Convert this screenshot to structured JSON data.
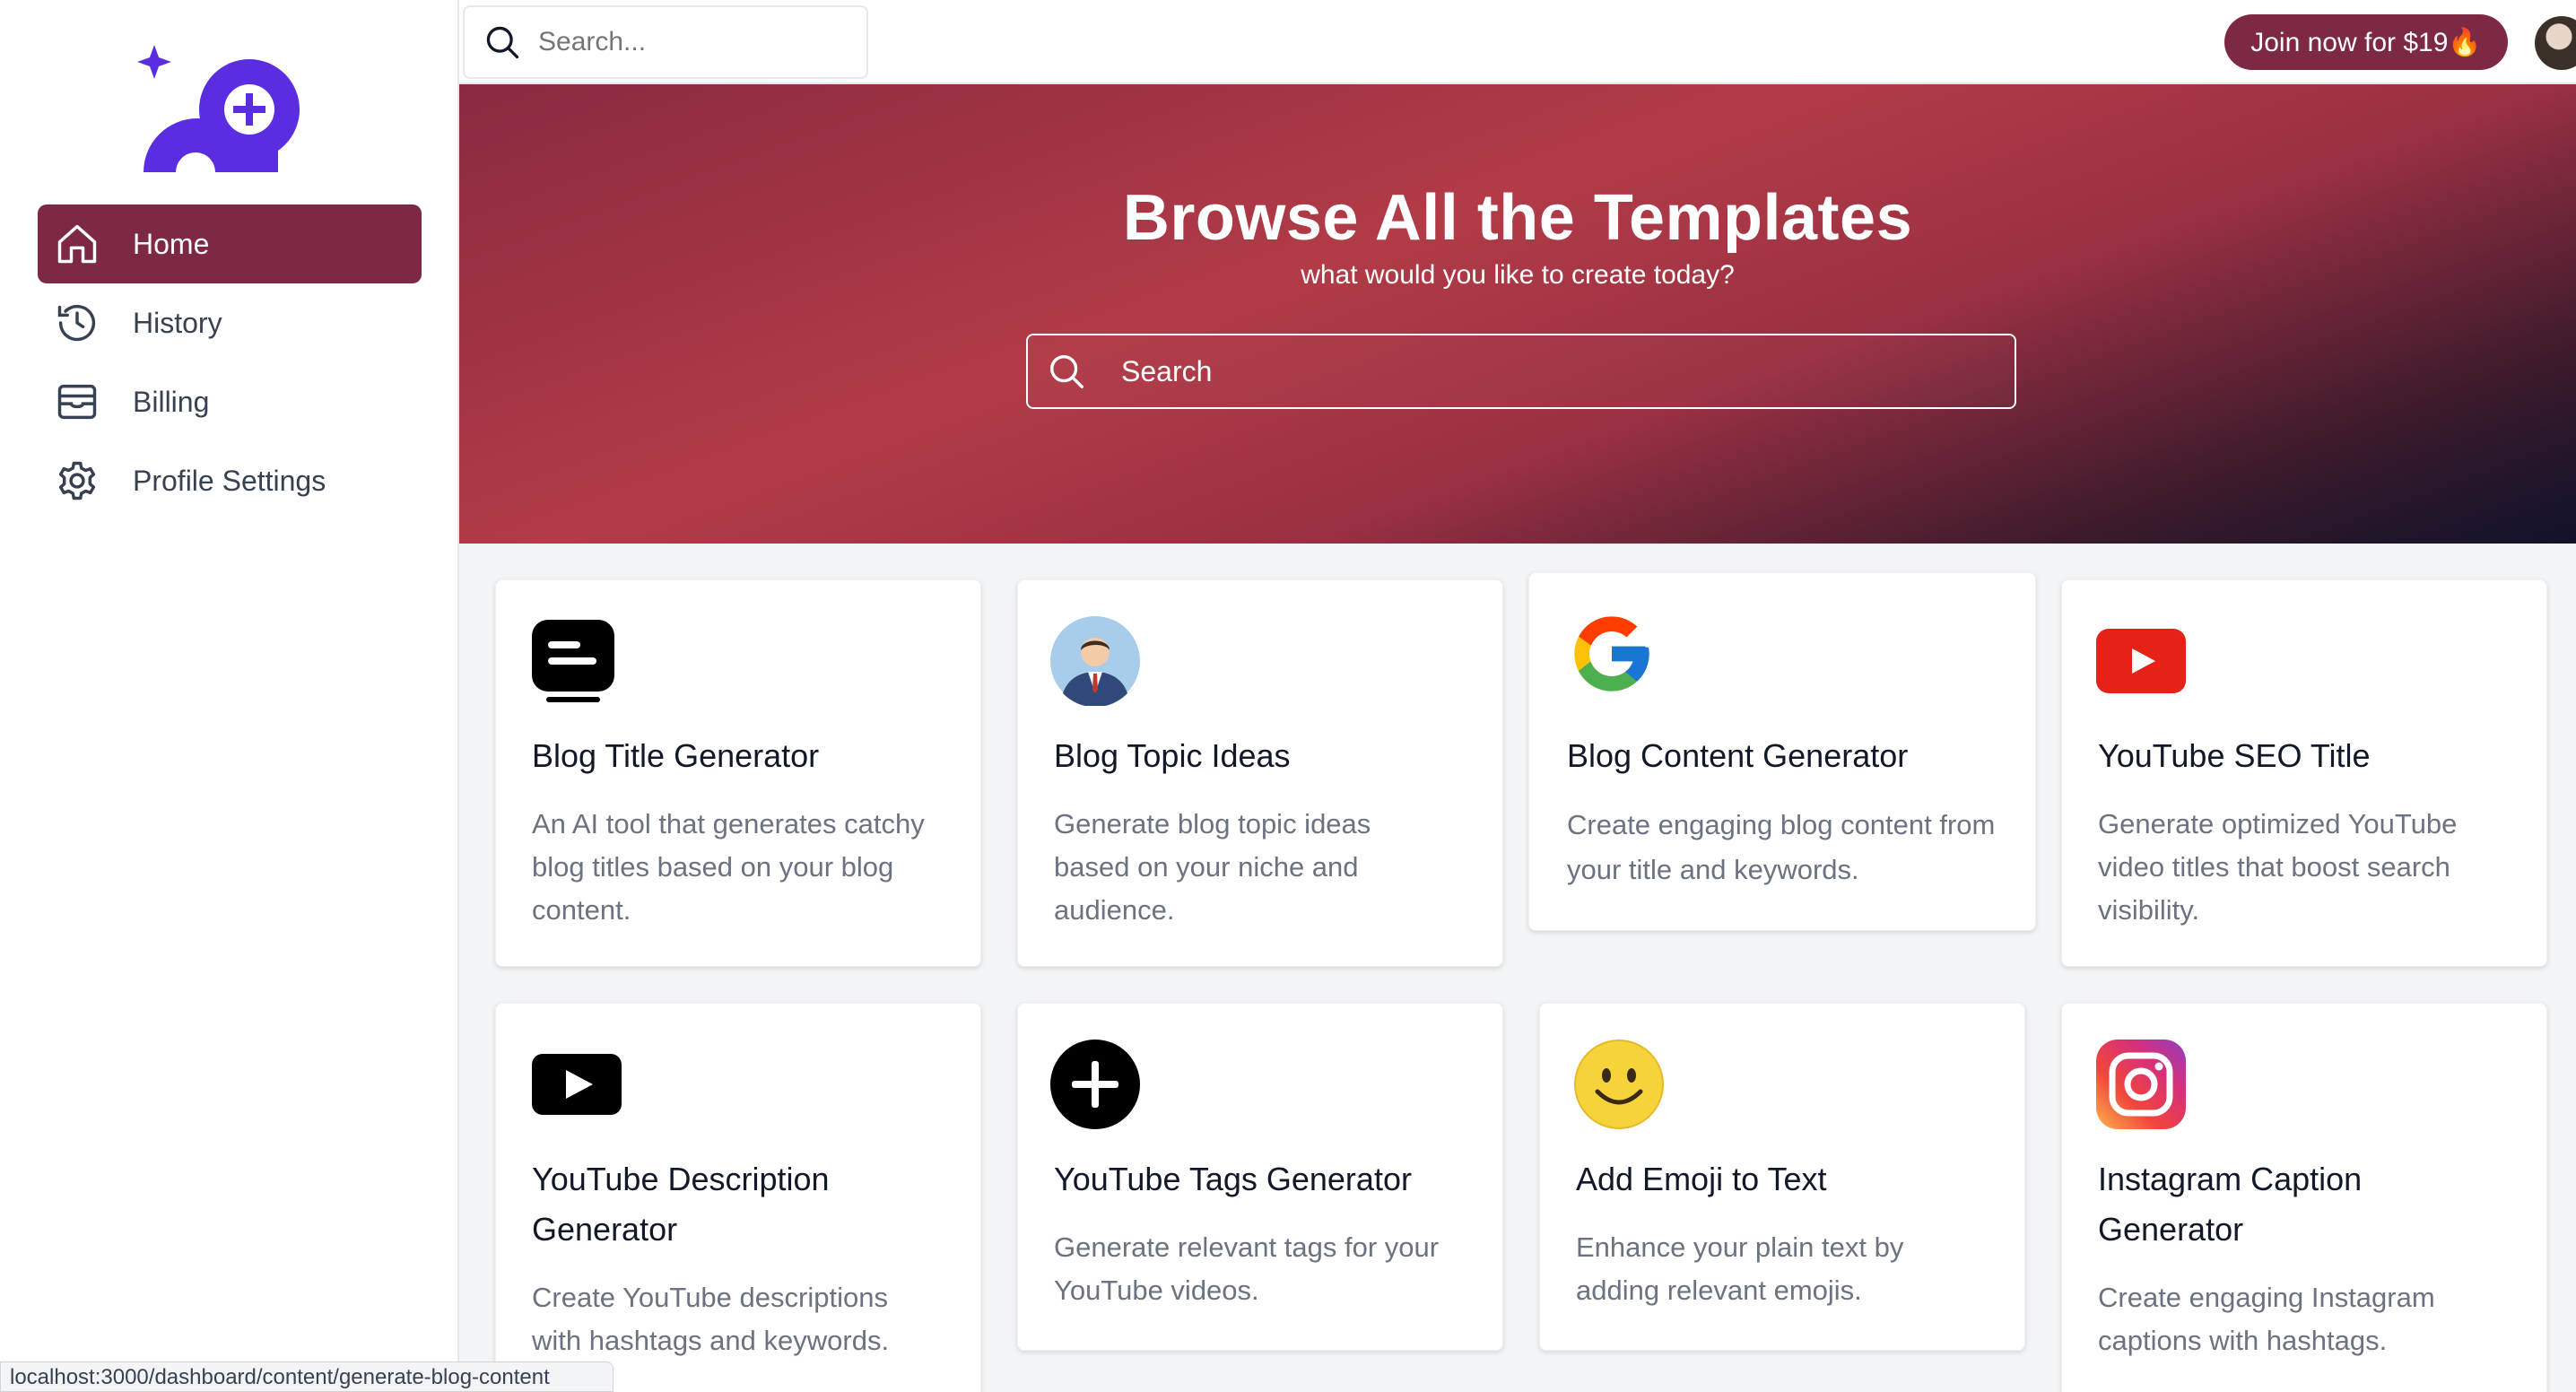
{
  "sidebar": {
    "logo_icon": "sparkle-controller-logo",
    "items": [
      {
        "label": "Home",
        "icon": "home-icon",
        "active": true
      },
      {
        "label": "History",
        "icon": "history-icon",
        "active": false
      },
      {
        "label": "Billing",
        "icon": "billing-icon",
        "active": false
      },
      {
        "label": "Profile Settings",
        "icon": "gear-icon",
        "active": false
      }
    ]
  },
  "topbar": {
    "search_placeholder": "Search...",
    "join_label": "Join now for $19🔥"
  },
  "hero": {
    "title": "Browse All the Templates",
    "subtitle": "what would you like to create today?",
    "search_placeholder": "Search"
  },
  "templates": [
    {
      "title": "Blog Title Generator",
      "desc": "An AI tool that generates catchy blog titles based on your blog content.",
      "icon": "blog-title-icon"
    },
    {
      "title": "Blog Topic Ideas",
      "desc": "Generate blog topic ideas based on your niche and audience.",
      "icon": "person-avatar-icon"
    },
    {
      "title": "Blog Content Generator",
      "desc": "Create engaging blog content from your title and keywords.",
      "icon": "google-icon"
    },
    {
      "title": "YouTube SEO Title",
      "desc": "Generate optimized YouTube video titles that boost search visibility.",
      "icon": "youtube-red-icon"
    },
    {
      "title": "YouTube Description Generator",
      "desc": "Create YouTube descriptions with hashtags and keywords.",
      "icon": "youtube-black-icon"
    },
    {
      "title": "YouTube Tags Generator",
      "desc": "Generate relevant tags for your YouTube videos.",
      "icon": "plus-circle-icon"
    },
    {
      "title": "Add Emoji to Text",
      "desc": "Enhance your plain text by adding relevant emojis.",
      "icon": "smiley-icon"
    },
    {
      "title": "Instagram Caption Generator",
      "desc": "Create engaging Instagram captions with hashtags.",
      "icon": "instagram-icon"
    }
  ],
  "status_url": "localhost:3000/dashboard/content/generate-blog-content",
  "colors": {
    "accent": "#7d2943",
    "hero_start": "#8a2a40",
    "hero_end": "#10122a"
  }
}
